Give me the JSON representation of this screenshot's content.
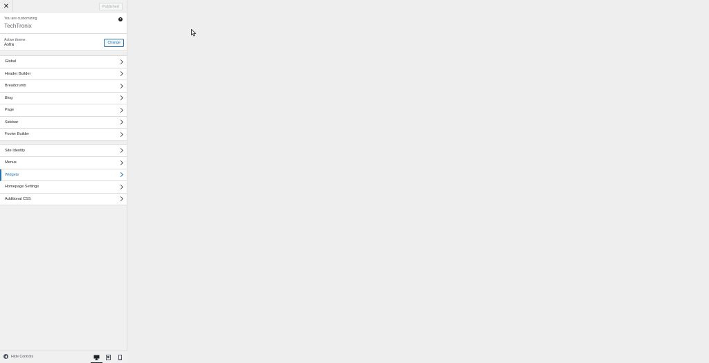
{
  "topbar": {
    "close_icon": "close-icon",
    "publish_label": "Published"
  },
  "info": {
    "customizing_label": "You are customizing",
    "site_title": "TechTronix",
    "help_icon": "help-icon"
  },
  "theme": {
    "label": "Active theme",
    "name": "Astra",
    "change_label": "Change"
  },
  "sections_group1": [
    "Global",
    "Header Builder",
    "Breadcrumb",
    "Blog",
    "Page",
    "Sidebar",
    "Footer Builder"
  ],
  "sections_group2": [
    "Site Identity",
    "Menus",
    "Widgets",
    "Homepage Settings",
    "Additional CSS"
  ],
  "active_section": "Widgets",
  "bottombar": {
    "hide_controls_label": "Hide Controls",
    "devices": [
      "desktop",
      "tablet",
      "mobile"
    ],
    "active_device": "desktop"
  },
  "colors": {
    "accent": "#2271b1",
    "sidebar_bg": "#f0f0f1",
    "preview_bg": "#eeeeee"
  }
}
